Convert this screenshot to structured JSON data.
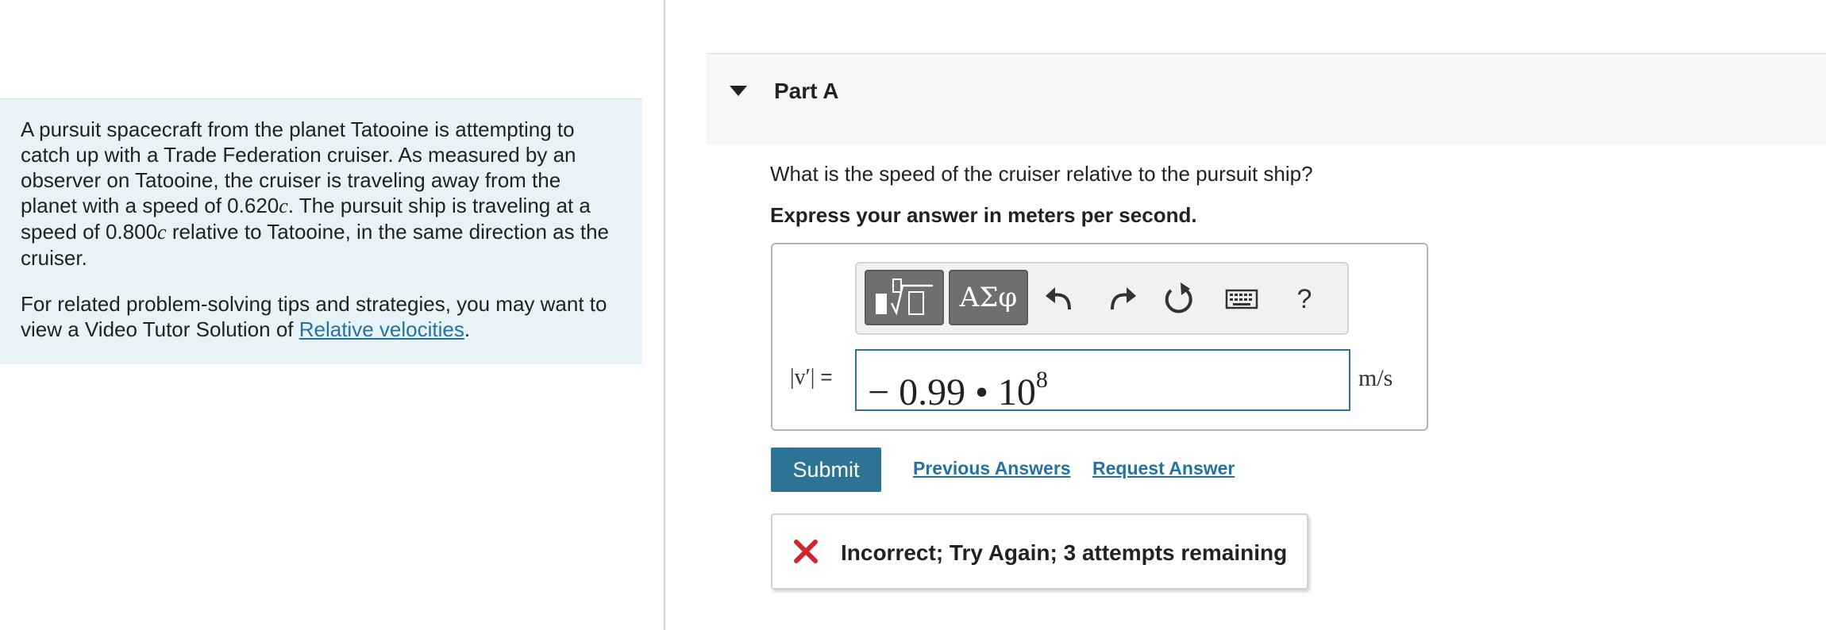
{
  "problem": {
    "paragraph1_part1": "A pursuit spacecraft from the planet Tatooine is attempting to catch up with a Trade Federation cruiser. As measured by an observer on Tatooine, the cruiser is traveling away from the planet with a speed of 0.620",
    "c1": "c",
    "paragraph1_part2": ". The pursuit ship is traveling at a speed of 0.800",
    "c2": "c",
    "paragraph1_part3": " relative to Tatooine, in the same direction as the cruiser.",
    "tip_text": "For related problem-solving tips and strategies, you may want to view a Video Tutor Solution of ",
    "tip_link": "Relative velocities",
    "tip_end": "."
  },
  "part": {
    "title": "Part A",
    "question": "What is the speed of the cruiser relative to the pursuit ship?",
    "instruction": "Express your answer in meters per second."
  },
  "toolbar": {
    "greek_label": "ΑΣφ",
    "help_label": "?"
  },
  "answer": {
    "variable_label": "|v′|",
    "equals": "=",
    "value_mantissa": "− 0.99 • 10",
    "value_exponent": "8",
    "unit": "m/s"
  },
  "actions": {
    "submit_label": "Submit",
    "previous_answers": "Previous Answers",
    "request_answer": "Request Answer"
  },
  "feedback": {
    "message": "Incorrect; Try Again; 3 attempts remaining",
    "status_color": "#d0272c"
  },
  "colors": {
    "accent": "#2c7395",
    "link": "#2472a4",
    "problem_bg": "#e7f3f6"
  }
}
